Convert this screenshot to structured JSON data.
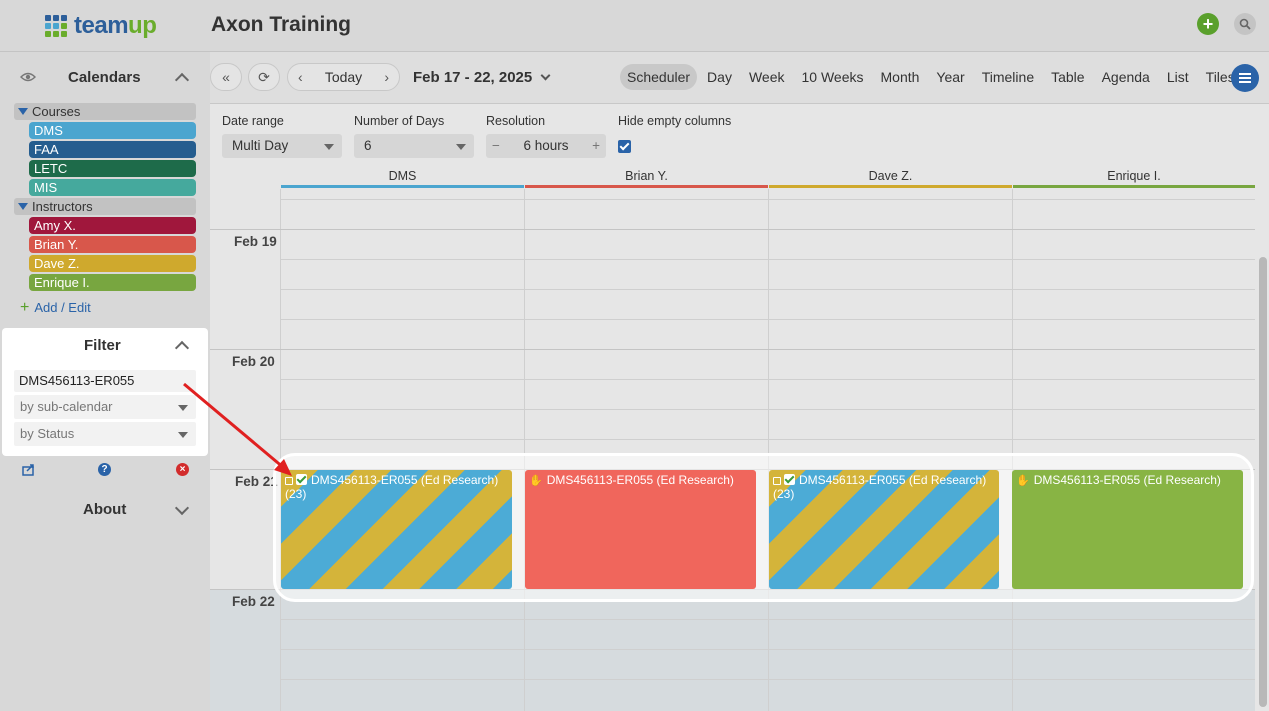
{
  "app": {
    "logo_text_1": "team",
    "logo_text_2": "up",
    "title": "Axon Training",
    "add_icon": "plus-icon",
    "search_icon": "search-icon"
  },
  "sidebar": {
    "calendars_title": "Calendars",
    "groups": [
      {
        "label": "Courses",
        "items": [
          {
            "label": "DMS",
            "color": "#4ba5cf"
          },
          {
            "label": "FAA",
            "color": "#255d8f"
          },
          {
            "label": "LETC",
            "color": "#1e6b4a"
          },
          {
            "label": "MIS",
            "color": "#45a99d"
          }
        ]
      },
      {
        "label": "Instructors",
        "items": [
          {
            "label": "Amy X.",
            "color": "#a0173c"
          },
          {
            "label": "Brian Y.",
            "color": "#d8574b"
          },
          {
            "label": "Dave Z.",
            "color": "#cfa92d"
          },
          {
            "label": "Enrique I.",
            "color": "#78a640"
          }
        ]
      }
    ],
    "add_edit": "Add / Edit",
    "filter": {
      "title": "Filter",
      "query": "DMS456113-ER055",
      "subcal_placeholder": "by sub-calendar",
      "status_placeholder": "by Status"
    },
    "about_title": "About"
  },
  "toolbar": {
    "today": "Today",
    "date_range": "Feb 17 - 22, 2025",
    "views": [
      "Scheduler",
      "Day",
      "Week",
      "10 Weeks",
      "Month",
      "Year",
      "Timeline",
      "Table",
      "Agenda",
      "List",
      "Tiles"
    ],
    "active_view": "Scheduler"
  },
  "controls": {
    "date_range_label": "Date range",
    "date_range_value": "Multi Day",
    "num_days_label": "Number of Days",
    "num_days_value": "6",
    "resolution_label": "Resolution",
    "resolution_value": "6 hours",
    "hide_empty_label": "Hide empty columns",
    "hide_empty_checked": true
  },
  "scheduler": {
    "columns": [
      {
        "label": "DMS",
        "color": "#4ba5cf"
      },
      {
        "label": "Brian Y.",
        "color": "#d8574b"
      },
      {
        "label": "Dave Z.",
        "color": "#cfa92d"
      },
      {
        "label": "Enrique I.",
        "color": "#78a640"
      }
    ],
    "days": [
      "Feb 19",
      "Feb 20",
      "Feb 21",
      "Feb 22"
    ],
    "events": [
      {
        "title": "DMS456113-ER055 (Ed Research)",
        "sub": "(23)",
        "style": "striped",
        "icons": [
          "copy-icon",
          "check-icon"
        ]
      },
      {
        "title": "DMS456113-ER055 (Ed Research)",
        "sub": "",
        "style": "#f0665c",
        "icons": [
          "hand-icon"
        ]
      },
      {
        "title": "DMS456113-ER055 (Ed Research)",
        "sub": "(23)",
        "style": "striped",
        "icons": [
          "copy-icon",
          "check-icon"
        ]
      },
      {
        "title": "DMS456113-ER055 (Ed Research)",
        "sub": "",
        "style": "#88b444",
        "icons": [
          "hand-icon"
        ]
      }
    ]
  }
}
